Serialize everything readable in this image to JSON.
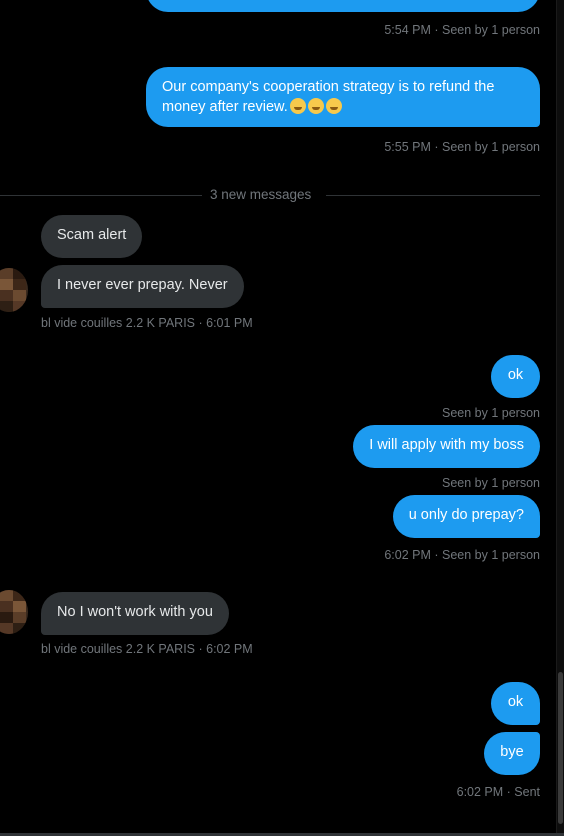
{
  "messages": [
    {
      "text": "Our company's cooperation strategy is to refund the money after review.",
      "emoji_count": 3
    },
    {
      "text": "Scam alert"
    },
    {
      "text": "I never ever prepay. Never"
    },
    {
      "text": "ok"
    },
    {
      "text": "I will apply with my boss"
    },
    {
      "text": "u only do prepay?"
    },
    {
      "text": "No I won't work with you"
    },
    {
      "text": "ok"
    },
    {
      "text": "bye"
    }
  ],
  "meta": {
    "m0": "5:54 PM · Seen by 1 person",
    "m1": "5:55 PM · Seen by 1 person",
    "m2": "bl vide couilles 2.2 K PARIS · 6:01 PM",
    "m3": "Seen by 1 person",
    "m4": "Seen by 1 person",
    "m5": "6:02 PM · Seen by 1 person",
    "m6": "bl vide couilles 2.2 K PARIS · 6:02 PM",
    "m7": "6:02 PM · Sent"
  },
  "divider": {
    "label": "3 new messages"
  },
  "colors": {
    "outgoing_bubble": "#1d9bf0",
    "incoming_bubble": "#2f3336",
    "background": "#000000",
    "meta_text": "#71767b"
  }
}
